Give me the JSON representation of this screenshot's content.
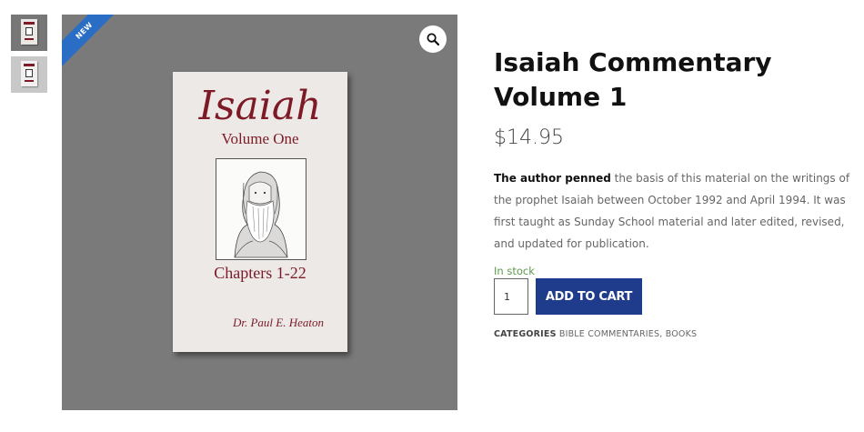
{
  "gallery": {
    "badge": "NEW",
    "zoom_icon": "magnifier-icon",
    "thumbnails": [
      {
        "label": "Isaiah Volume One cover",
        "active": true
      },
      {
        "label": "Isaiah Volume One cover alt",
        "active": false
      }
    ],
    "book_cover": {
      "title": "Isaiah",
      "subtitle": "Volume One",
      "chapters": "Chapters 1-22",
      "author": "Dr. Paul E. Heaton"
    }
  },
  "product": {
    "title": "Isaiah Commentary Volume 1",
    "price": "$14.95",
    "description_lead": "The author penned",
    "description_rest": " the basis of this material on the writings of the prophet Isaiah between October 1992 and April 1994. It was first taught as Sunday School material and later edited, revised, and updated for publication.",
    "stock": "In stock",
    "quantity": "1",
    "add_to_cart": "ADD TO CART",
    "categories_label": "CATEGORIES",
    "categories": [
      "BIBLE COMMENTARIES",
      "BOOKS"
    ],
    "categories_separator": ", "
  },
  "colors": {
    "accent": "#1f3c8c",
    "badge": "#2a6dc5",
    "stock": "#5e9a4c",
    "cover_text": "#7d1a26"
  }
}
